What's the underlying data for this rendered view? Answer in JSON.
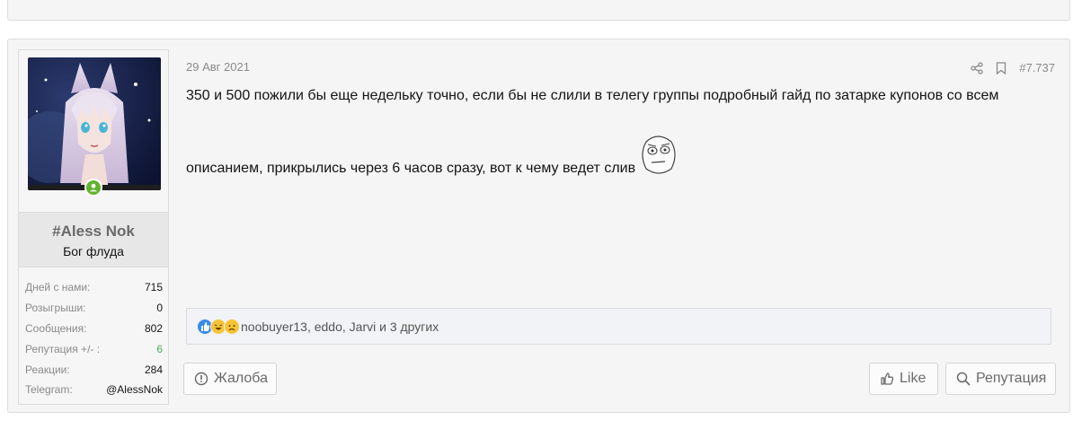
{
  "post": {
    "date": "29 Авг 2021",
    "post_number": "#7.737",
    "body_line1": "350 и 500 пожили бы еще недельку точно, если бы не слили в телегу группы подробный гайд по затарке купонов со всем",
    "body_line2": "описанием, прикрылись через 6 часов сразу, вот к чему ведет слив"
  },
  "user": {
    "name": "#Aless Nok",
    "title": "Бог флуда",
    "stats": [
      {
        "label": "Дней с нами:",
        "value": "715"
      },
      {
        "label": "Розыгрыши:",
        "value": "0"
      },
      {
        "label": "Сообщения:",
        "value": "802"
      },
      {
        "label": "Репутация +/- :",
        "value": "6"
      },
      {
        "label": "Реакции:",
        "value": "284"
      },
      {
        "label": "Telegram:",
        "value": "@AlessNok"
      }
    ]
  },
  "reactions": {
    "text": "noobuyer13, eddo, Jarvi и 3 других",
    "icons": [
      "like-icon",
      "laugh-icon",
      "sad-icon"
    ]
  },
  "buttons": {
    "report": "Жалоба",
    "like": "Like",
    "reputation": "Репутация"
  },
  "colors": {
    "online": "#63b22d",
    "positive_rep": "#4caf50",
    "like_reaction": "#3b88e8"
  }
}
